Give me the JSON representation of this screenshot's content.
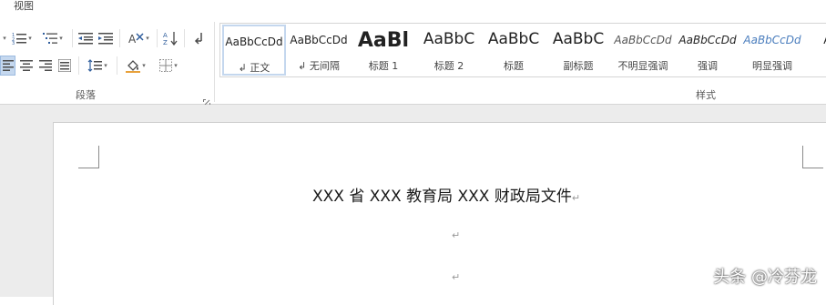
{
  "menu": {
    "view_label": "视图"
  },
  "ribbon": {
    "paragraph_group_label": "段落",
    "styles_group_label": "样式",
    "styles": [
      {
        "sample": "AaBbCcDd",
        "name": "↲ 正文",
        "selected": true
      },
      {
        "sample": "AaBbCcDd",
        "name": "↲ 无间隔"
      },
      {
        "sample": "AaBl",
        "name": "标题 1"
      },
      {
        "sample": "AaBbC",
        "name": "标题 2"
      },
      {
        "sample": "AaBbC",
        "name": "标题"
      },
      {
        "sample": "AaBbC",
        "name": "副标题"
      },
      {
        "sample": "AaBbCcDd",
        "name": "不明显强调"
      },
      {
        "sample": "AaBbCcDd",
        "name": "强调"
      },
      {
        "sample": "AaBbCcDd",
        "name": "明显强调"
      },
      {
        "sample": "AaBb",
        "name": ""
      }
    ]
  },
  "document": {
    "title_line": "XXX 省 XXX 教育局 XXX 财政局文件",
    "paragraph_mark": "↵"
  },
  "watermark": {
    "text": "头条 @冷芬龙"
  }
}
